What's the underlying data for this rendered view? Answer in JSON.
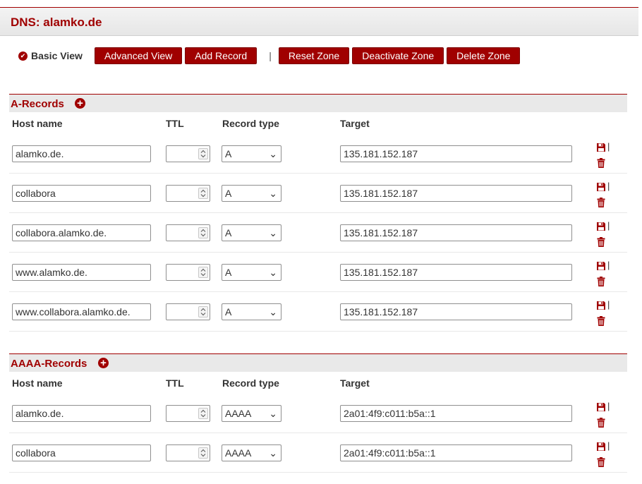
{
  "page": {
    "title": "DNS: alamko.de"
  },
  "toolbar": {
    "basic_view": "Basic View",
    "advanced_view": "Advanced View",
    "add_record": "Add Record",
    "separator": "|",
    "reset_zone": "Reset Zone",
    "deactivate_zone": "Deactivate Zone",
    "delete_zone": "Delete Zone"
  },
  "columns": {
    "host": "Host name",
    "ttl": "TTL",
    "type": "Record type",
    "target": "Target"
  },
  "a_section": {
    "title": "A-Records",
    "rows": [
      {
        "host": "alamko.de.",
        "ttl": "",
        "type": "A",
        "target": "135.181.152.187"
      },
      {
        "host": "collabora",
        "ttl": "",
        "type": "A",
        "target": "135.181.152.187"
      },
      {
        "host": "collabora.alamko.de.",
        "ttl": "",
        "type": "A",
        "target": "135.181.152.187"
      },
      {
        "host": "www.alamko.de.",
        "ttl": "",
        "type": "A",
        "target": "135.181.152.187"
      },
      {
        "host": "www.collabora.alamko.de.",
        "ttl": "",
        "type": "A",
        "target": "135.181.152.187"
      }
    ]
  },
  "aaaa_section": {
    "title": "AAAA-Records",
    "rows": [
      {
        "host": "alamko.de.",
        "ttl": "",
        "type": "AAAA",
        "target": "2a01:4f9:c011:b5a::1"
      },
      {
        "host": "collabora",
        "ttl": "",
        "type": "AAAA",
        "target": "2a01:4f9:c011:b5a::1"
      }
    ]
  },
  "row_action_separator": "|",
  "colors": {
    "accent": "#a00000",
    "header_bg": "#e9e9e9"
  },
  "icons": {
    "save": "floppy-disk-icon",
    "delete": "trash-icon",
    "add": "plus-circle-icon",
    "check": "check-circle-icon",
    "spinner": "spinner-arrows-icon",
    "dropdown": "chevron-down-icon"
  }
}
